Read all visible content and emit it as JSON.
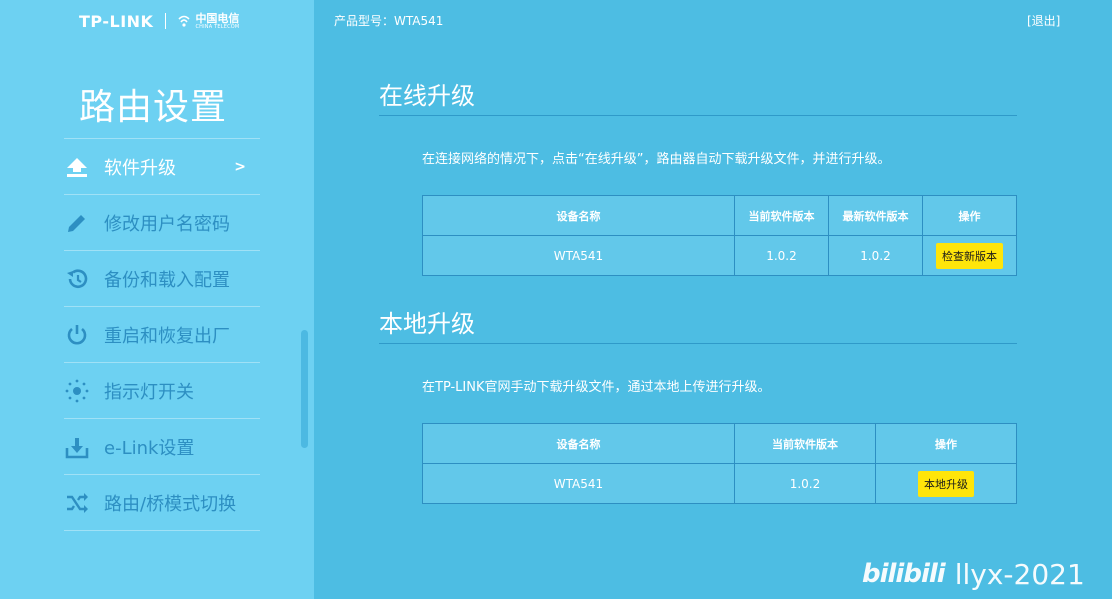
{
  "header": {
    "brand_tplink": "TP-LINK",
    "brand_telecom_cn": "中国电信",
    "brand_telecom_en": "CHINA TELECOM",
    "model_label": "产品型号：WTA541",
    "logout": "[退出]"
  },
  "sidebar": {
    "title": "路由设置",
    "items": [
      {
        "label": "软件升级",
        "icon": "upload-icon",
        "active": true,
        "arrow": ">"
      },
      {
        "label": "修改用户名密码",
        "icon": "pencil-icon",
        "active": false
      },
      {
        "label": "备份和载入配置",
        "icon": "history-icon",
        "active": false
      },
      {
        "label": "重启和恢复出厂",
        "icon": "power-icon",
        "active": false
      },
      {
        "label": "指示灯开关",
        "icon": "light-icon",
        "active": false
      },
      {
        "label": "e-Link设置",
        "icon": "download-tray-icon",
        "active": false
      },
      {
        "label": "路由/桥模式切换",
        "icon": "shuffle-icon",
        "active": false
      }
    ]
  },
  "online_upgrade": {
    "title": "在线升级",
    "description": "在连接网络的情况下，点击“在线升级”，路由器自动下载升级文件，并进行升级。",
    "columns": [
      "设备名称",
      "当前软件版本",
      "最新软件版本",
      "操作"
    ],
    "row": {
      "device": "WTA541",
      "current": "1.0.2",
      "latest": "1.0.2",
      "action": "检查新版本"
    }
  },
  "local_upgrade": {
    "title": "本地升级",
    "description": "在TP-LINK官网手动下载升级文件，通过本地上传进行升级。",
    "columns": [
      "设备名称",
      "当前软件版本",
      "操作"
    ],
    "row": {
      "device": "WTA541",
      "current": "1.0.2",
      "action": "本地升级"
    }
  },
  "watermark": {
    "site": "bilibili",
    "user": "llyx-2021"
  },
  "colors": {
    "background": "#4dbde3",
    "sidebar": "#6dd1f2",
    "menu_text": "#2d8fc2",
    "button": "#ffe50a"
  }
}
